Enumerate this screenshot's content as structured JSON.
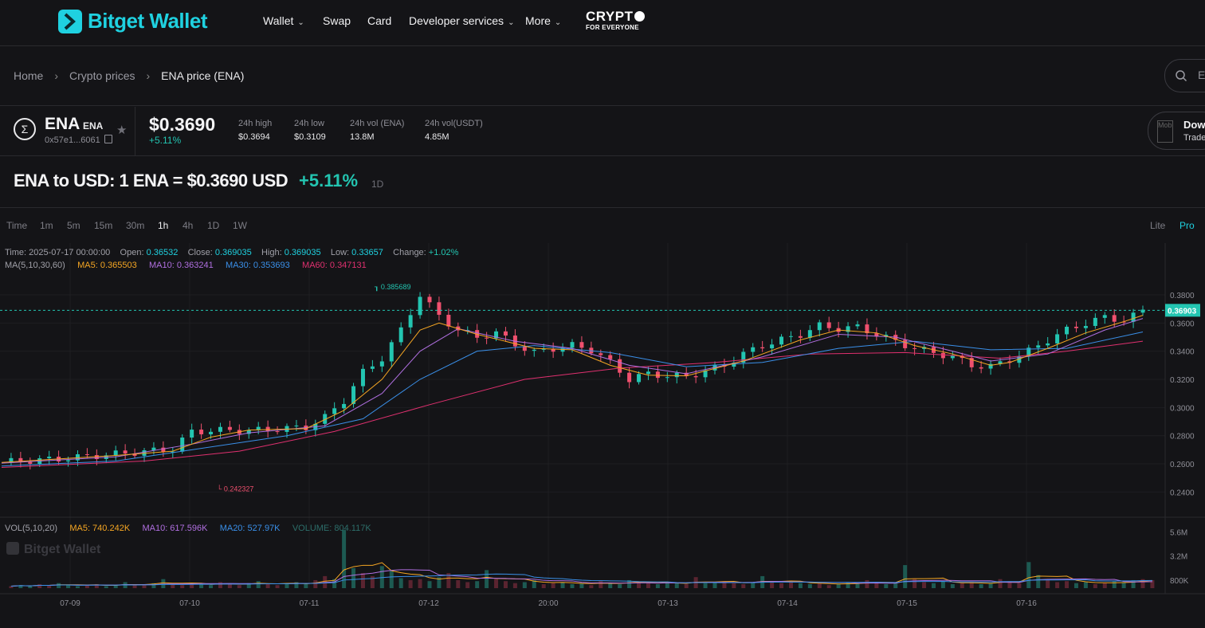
{
  "brand": {
    "name": "Bitget Wallet",
    "accent": "#1fd1e0"
  },
  "nav": {
    "items": [
      {
        "label": "Wallet",
        "dropdown": true
      },
      {
        "label": "Swap",
        "dropdown": false
      },
      {
        "label": "Card",
        "dropdown": false
      },
      {
        "label": "Developer services",
        "dropdown": true
      },
      {
        "label": "More",
        "dropdown": true
      }
    ],
    "badge": {
      "line1": "CRYPT",
      "line2": "FOR EVERYONE"
    }
  },
  "breadcrumb": {
    "home": "Home",
    "crypto_prices": "Crypto prices",
    "current": "ENA price (ENA)"
  },
  "search": {
    "placeholder": "E"
  },
  "token": {
    "symbol": "ENA",
    "ticker": "ENA",
    "address": "0x57e1...6061",
    "price": "$0.3690",
    "change": "+5.11%",
    "stats": [
      {
        "label": "24h high",
        "value": "$0.3694"
      },
      {
        "label": "24h low",
        "value": "$0.3109"
      },
      {
        "label": "24h vol (ENA)",
        "value": "13.8M"
      },
      {
        "label": "24h vol(USDT)",
        "value": "4.85M"
      }
    ]
  },
  "download": {
    "title": "Dow",
    "subtitle": "Trade",
    "alt": "Mob"
  },
  "headline": {
    "text": "ENA to USD: 1 ENA = $0.3690 USD",
    "change": "+5.11%",
    "period": "1D"
  },
  "timeframes": [
    "Time",
    "1m",
    "5m",
    "15m",
    "30m",
    "1h",
    "4h",
    "1D",
    "1W"
  ],
  "active_timeframe": "1h",
  "view_modes": [
    "Lite",
    "Pro"
  ],
  "active_view": "Pro",
  "ohlc": {
    "time_label": "Time:",
    "time": "2025-07-17 00:00:00",
    "open_label": "Open:",
    "open": "0.36532",
    "close_label": "Close:",
    "close": "0.369035",
    "high_label": "High:",
    "high": "0.369035",
    "low_label": "Low:",
    "low": "0.33657",
    "change_label": "Change:",
    "change": "+1.02%"
  },
  "ma_legend": {
    "title": "MA(5,10,30,60)",
    "ma5": "MA5: 0.365503",
    "ma10": "MA10: 0.363241",
    "ma30": "MA30: 0.353693",
    "ma60": "MA60: 0.347131"
  },
  "vol_legend": {
    "title": "VOL(5,10,20)",
    "ma5": "MA5: 740.242K",
    "ma10": "MA10: 617.596K",
    "ma20": "MA20: 527.97K",
    "volume": "VOLUME: 804.117K"
  },
  "watermark": "Bitget Wallet",
  "colors": {
    "up": "#23c5b1",
    "down": "#f0506e",
    "ma5": "#f5a623",
    "ma10": "#b06fe0",
    "ma30": "#3a8fe8",
    "ma60": "#e0306f"
  },
  "chart_data": {
    "type": "candlestick",
    "price_axis_ticks": [
      "0.3800",
      "0.3600",
      "0.3400",
      "0.3200",
      "0.3000",
      "0.2800",
      "0.2600",
      "0.2400"
    ],
    "price_ylim": [
      0.234,
      0.3913
    ],
    "volume_axis_ticks": [
      "5.6M",
      "3.2M",
      "800K"
    ],
    "volume_ylim": [
      0,
      6.2
    ],
    "x_labels": [
      "07-09",
      "07-10",
      "07-11",
      "07-12",
      "20:00",
      "07-13",
      "07-14",
      "07-15",
      "07-16"
    ],
    "current_price": "0.36903",
    "max_label": "0.385689",
    "min_label": "0.242327",
    "price_series": [
      [
        0,
        0.2612
      ],
      [
        6,
        0.2635
      ],
      [
        12,
        0.267
      ],
      [
        18,
        0.2705
      ],
      [
        20,
        0.283
      ],
      [
        24,
        0.284
      ],
      [
        26,
        0.2835
      ],
      [
        32,
        0.286
      ],
      [
        34,
        0.293
      ],
      [
        36,
        0.305
      ],
      [
        38,
        0.325
      ],
      [
        40,
        0.335
      ],
      [
        42,
        0.355
      ],
      [
        44,
        0.38
      ],
      [
        46,
        0.365
      ],
      [
        48,
        0.355
      ],
      [
        50,
        0.35
      ],
      [
        52,
        0.353
      ],
      [
        54,
        0.345
      ],
      [
        56,
        0.339
      ],
      [
        58,
        0.342
      ],
      [
        60,
        0.344
      ],
      [
        62,
        0.341
      ],
      [
        64,
        0.332
      ],
      [
        66,
        0.32
      ],
      [
        68,
        0.324
      ],
      [
        70,
        0.3225
      ],
      [
        72,
        0.322
      ],
      [
        74,
        0.326
      ],
      [
        76,
        0.33
      ],
      [
        78,
        0.338
      ],
      [
        80,
        0.344
      ],
      [
        82,
        0.348
      ],
      [
        84,
        0.352
      ],
      [
        86,
        0.358
      ],
      [
        88,
        0.356
      ],
      [
        90,
        0.357
      ],
      [
        92,
        0.352
      ],
      [
        94,
        0.347
      ],
      [
        96,
        0.342
      ],
      [
        98,
        0.339
      ],
      [
        100,
        0.336
      ],
      [
        102,
        0.33
      ],
      [
        104,
        0.329
      ],
      [
        106,
        0.334
      ],
      [
        108,
        0.34
      ],
      [
        110,
        0.348
      ],
      [
        112,
        0.355
      ],
      [
        114,
        0.36
      ],
      [
        116,
        0.364
      ],
      [
        118,
        0.362
      ],
      [
        119,
        0.365
      ],
      [
        120,
        0.369
      ]
    ],
    "ma5_series": [
      [
        0,
        0.261
      ],
      [
        12,
        0.266
      ],
      [
        18,
        0.269
      ],
      [
        22,
        0.279
      ],
      [
        26,
        0.284
      ],
      [
        32,
        0.285
      ],
      [
        36,
        0.298
      ],
      [
        40,
        0.32
      ],
      [
        44,
        0.355
      ],
      [
        46,
        0.36
      ],
      [
        50,
        0.352
      ],
      [
        56,
        0.342
      ],
      [
        60,
        0.341
      ],
      [
        64,
        0.33
      ],
      [
        68,
        0.323
      ],
      [
        72,
        0.3225
      ],
      [
        78,
        0.333
      ],
      [
        84,
        0.348
      ],
      [
        88,
        0.355
      ],
      [
        92,
        0.353
      ],
      [
        96,
        0.344
      ],
      [
        100,
        0.338
      ],
      [
        104,
        0.33
      ],
      [
        106,
        0.332
      ],
      [
        110,
        0.342
      ],
      [
        114,
        0.353
      ],
      [
        118,
        0.361
      ],
      [
        120,
        0.3655
      ]
    ],
    "ma10_series": [
      [
        0,
        0.2605
      ],
      [
        12,
        0.265
      ],
      [
        20,
        0.274
      ],
      [
        26,
        0.282
      ],
      [
        34,
        0.287
      ],
      [
        40,
        0.31
      ],
      [
        44,
        0.34
      ],
      [
        48,
        0.356
      ],
      [
        54,
        0.347
      ],
      [
        60,
        0.342
      ],
      [
        66,
        0.33
      ],
      [
        72,
        0.324
      ],
      [
        80,
        0.336
      ],
      [
        88,
        0.352
      ],
      [
        94,
        0.35
      ],
      [
        100,
        0.34
      ],
      [
        104,
        0.333
      ],
      [
        110,
        0.338
      ],
      [
        116,
        0.355
      ],
      [
        120,
        0.3632
      ]
    ],
    "ma30_series": [
      [
        0,
        0.2585
      ],
      [
        12,
        0.262
      ],
      [
        20,
        0.27
      ],
      [
        30,
        0.28
      ],
      [
        38,
        0.292
      ],
      [
        44,
        0.32
      ],
      [
        50,
        0.34
      ],
      [
        56,
        0.344
      ],
      [
        64,
        0.339
      ],
      [
        72,
        0.329
      ],
      [
        80,
        0.332
      ],
      [
        88,
        0.342
      ],
      [
        96,
        0.347
      ],
      [
        104,
        0.341
      ],
      [
        112,
        0.342
      ],
      [
        120,
        0.3537
      ]
    ],
    "ma60_series": [
      [
        0,
        0.2575
      ],
      [
        15,
        0.262
      ],
      [
        25,
        0.269
      ],
      [
        35,
        0.283
      ],
      [
        45,
        0.302
      ],
      [
        55,
        0.32
      ],
      [
        65,
        0.328
      ],
      [
        75,
        0.332
      ],
      [
        85,
        0.338
      ],
      [
        95,
        0.339
      ],
      [
        105,
        0.335
      ],
      [
        112,
        0.34
      ],
      [
        120,
        0.3471
      ]
    ],
    "volume_series": [
      0.2,
      0.3,
      0.2,
      0.4,
      0.3,
      0.5,
      0.3,
      0.2,
      0.3,
      0.4,
      0.2,
      0.3,
      0.6,
      0.3,
      0.4,
      0.5,
      0.9,
      0.4,
      0.3,
      0.5,
      0.4,
      0.3,
      0.6,
      0.4,
      0.3,
      0.5,
      0.7,
      0.4,
      0.3,
      0.5,
      0.6,
      0.4,
      0.8,
      1.2,
      0.9,
      5.8,
      2.0,
      1.5,
      1.2,
      2.2,
      1.8,
      1.0,
      0.8,
      0.9,
      0.7,
      1.1,
      1.5,
      0.8,
      0.6,
      0.7,
      1.8,
      0.9,
      0.7,
      0.5,
      0.6,
      0.8,
      0.4,
      0.5,
      0.6,
      0.4,
      0.5,
      0.3,
      0.7,
      0.5,
      0.4,
      0.8,
      0.6,
      0.5,
      0.4,
      0.6,
      0.5,
      0.4,
      1.1,
      0.5,
      0.6,
      0.7,
      0.5,
      0.4,
      0.6,
      1.2,
      0.7,
      0.5,
      0.6,
      0.5,
      0.4,
      0.5,
      0.3,
      0.4,
      0.6,
      0.5,
      0.8,
      0.6,
      0.4,
      0.5,
      2.3,
      0.9,
      0.6,
      0.5,
      0.7,
      0.4,
      0.5,
      0.6,
      0.4,
      0.5,
      0.9,
      0.7,
      0.5,
      2.6,
      1.3,
      0.8,
      0.6,
      0.7,
      0.5,
      0.6,
      0.4,
      0.5,
      0.7,
      0.6,
      0.8,
      0.9,
      0.8
    ]
  }
}
